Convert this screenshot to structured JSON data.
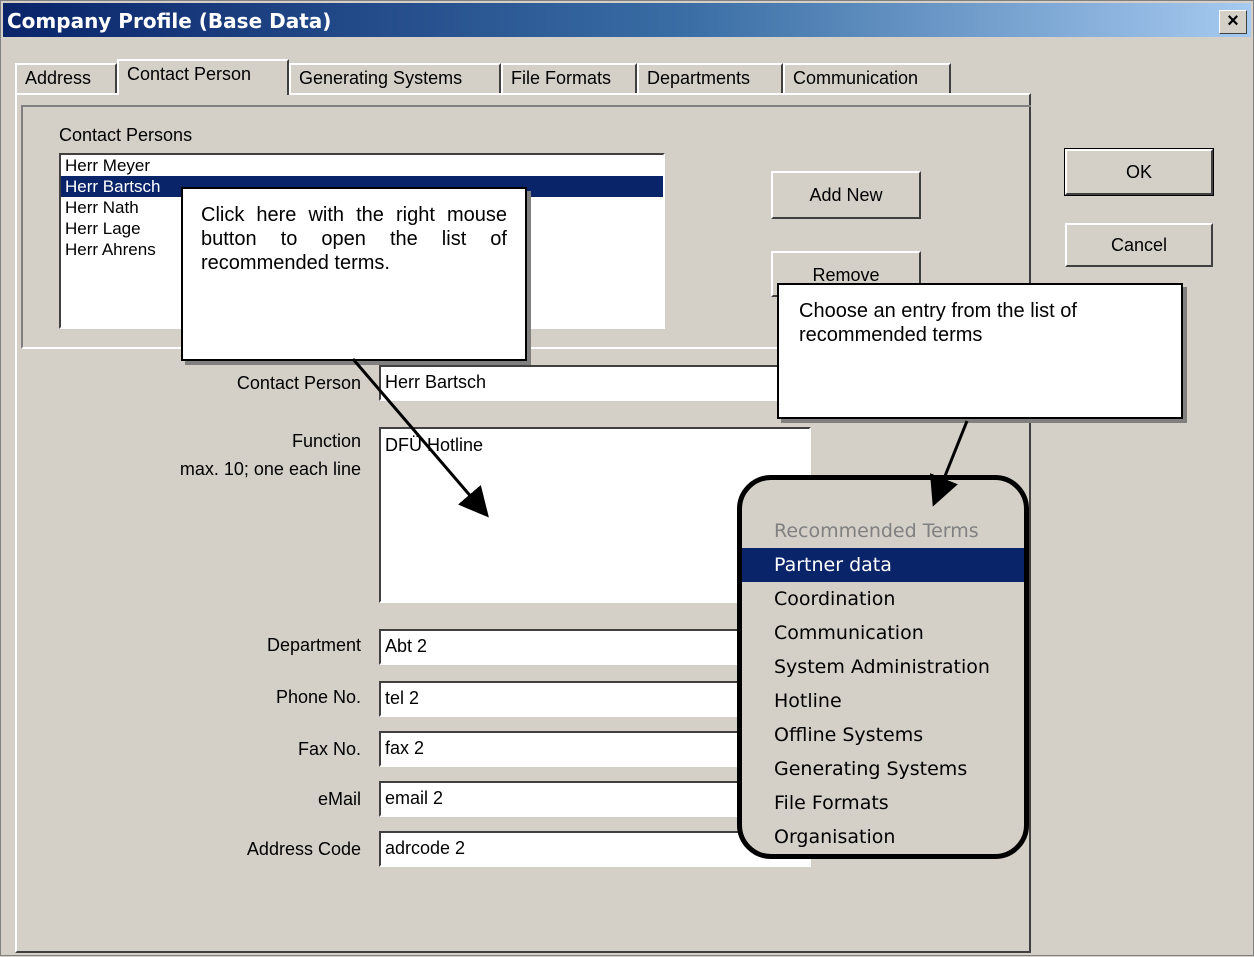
{
  "window": {
    "title": "Company Profile (Base Data)",
    "close_label": "×"
  },
  "tabs": [
    {
      "label": "Address"
    },
    {
      "label": "Contact Person",
      "active": true
    },
    {
      "label": "Generating Systems"
    },
    {
      "label": "File Formats"
    },
    {
      "label": "Departments"
    },
    {
      "label": "Communication"
    }
  ],
  "contacts": {
    "group_label": "Contact Persons",
    "items": [
      "Herr Meyer",
      "Herr Bartsch",
      "Herr Nath",
      "Herr Lage",
      "Herr Ahrens"
    ],
    "selected": "Herr Bartsch"
  },
  "buttons": {
    "add_new": "Add New",
    "remove": "Remove",
    "ok": "OK",
    "cancel": "Cancel"
  },
  "form": {
    "contact_person": {
      "label": "Contact Person",
      "value": "Herr Bartsch"
    },
    "function": {
      "label": "Function",
      "hint": "max. 10; one each line",
      "value": "DFÜ Hotline"
    },
    "department": {
      "label": "Department",
      "value": "Abt 2"
    },
    "phone": {
      "label": "Phone No.",
      "value": "tel 2"
    },
    "fax": {
      "label": "Fax No.",
      "value": "fax 2"
    },
    "email": {
      "label": "eMail",
      "value": "email 2"
    },
    "address_code": {
      "label": "Address Code",
      "value": "adrcode 2"
    }
  },
  "callouts": {
    "left": "Click here with the right mouse button to open the list of recommended terms.",
    "right": "Choose an entry from the list of recommended terms"
  },
  "context_menu": {
    "header": "Recommended Terms",
    "items": [
      "Partner data",
      "Coordination",
      "Communication",
      "System Administration",
      "Hotline",
      "Offline Systems",
      "Generating Systems",
      "File Formats",
      "Organisation"
    ],
    "highlighted": "Partner data"
  }
}
